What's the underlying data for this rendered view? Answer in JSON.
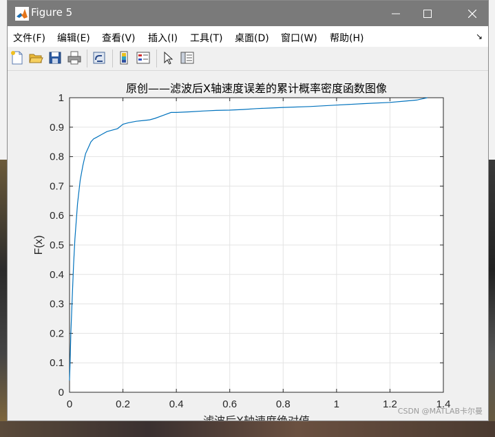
{
  "window": {
    "title": "Figure 5"
  },
  "menu": {
    "items": [
      "文件(F)",
      "编辑(E)",
      "查看(V)",
      "插入(I)",
      "工具(T)",
      "桌面(D)",
      "窗口(W)",
      "帮助(H)"
    ]
  },
  "toolbar": {
    "icons": [
      "new-figure-icon",
      "open-file-icon",
      "save-icon",
      "print-icon",
      "link-icon",
      "colorbar-icon",
      "legend-icon",
      "select-pointer-icon",
      "property-inspector-icon"
    ]
  },
  "watermark": "CSDN @MATLAB卡尔曼",
  "chart_data": {
    "type": "line",
    "title": "原创——滤波后X轴速度误差的累计概率密度函数图像",
    "xlabel": "滤波后X轴速度绝对值",
    "ylabel": "F(x)",
    "xlim": [
      0,
      1.4
    ],
    "ylim": [
      0,
      1
    ],
    "xticks": [
      "0",
      "0.2",
      "0.4",
      "0.6",
      "0.8",
      "1",
      "1.2",
      "1.4"
    ],
    "yticks": [
      "0",
      "0.1",
      "0.2",
      "0.3",
      "0.4",
      "0.5",
      "0.6",
      "0.7",
      "0.8",
      "0.9",
      "1"
    ],
    "grid": true,
    "series": [
      {
        "color": "#0072bd",
        "x": [
          0.0,
          0.002,
          0.005,
          0.01,
          0.015,
          0.02,
          0.03,
          0.04,
          0.05,
          0.06,
          0.07,
          0.08,
          0.09,
          0.1,
          0.12,
          0.14,
          0.16,
          0.18,
          0.2,
          0.22,
          0.25,
          0.28,
          0.3,
          0.32,
          0.35,
          0.38,
          0.4,
          0.45,
          0.5,
          0.55,
          0.6,
          0.65,
          0.7,
          0.75,
          0.8,
          0.9,
          1.0,
          1.1,
          1.2,
          1.25,
          1.3,
          1.32,
          1.34
        ],
        "y": [
          0.04,
          0.1,
          0.2,
          0.32,
          0.43,
          0.52,
          0.64,
          0.72,
          0.77,
          0.81,
          0.83,
          0.85,
          0.86,
          0.865,
          0.875,
          0.885,
          0.89,
          0.895,
          0.91,
          0.915,
          0.92,
          0.923,
          0.925,
          0.93,
          0.94,
          0.95,
          0.95,
          0.952,
          0.955,
          0.957,
          0.958,
          0.96,
          0.963,
          0.965,
          0.967,
          0.97,
          0.975,
          0.98,
          0.984,
          0.988,
          0.992,
          0.996,
          1.0
        ]
      }
    ]
  }
}
